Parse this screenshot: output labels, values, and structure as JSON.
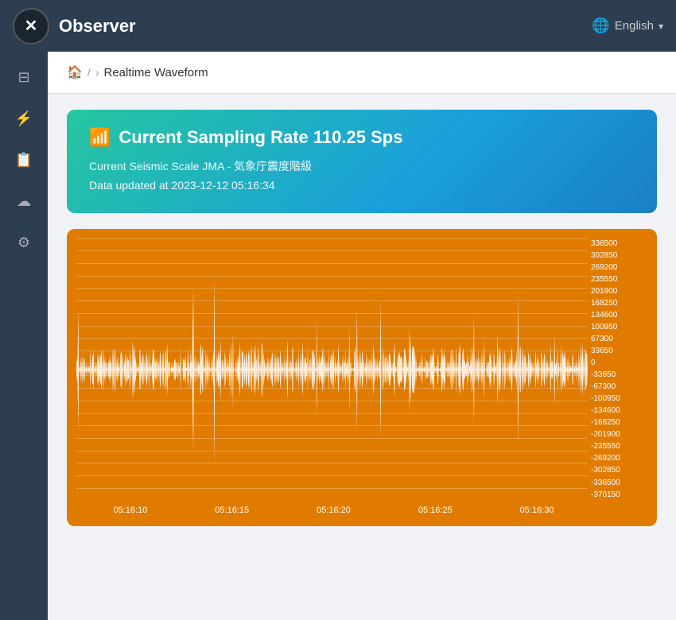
{
  "header": {
    "title": "Observer",
    "logo_symbol": "✕",
    "language": "English"
  },
  "sidebar": {
    "items": [
      {
        "icon": "⊟",
        "name": "dashboard"
      },
      {
        "icon": "⚡",
        "name": "waveform"
      },
      {
        "icon": "📋",
        "name": "reports"
      },
      {
        "icon": "☁",
        "name": "cloud"
      },
      {
        "icon": "⚙",
        "name": "settings"
      }
    ]
  },
  "breadcrumb": {
    "home_label": "🏠",
    "separator1": "/",
    "separator2": "›",
    "page": "Realtime Waveform"
  },
  "info_card": {
    "title": "Current Sampling Rate 110.25 Sps",
    "subtitle1": "Current Seismic Scale JMA - 気象庁震度階級",
    "subtitle2": "Data updated at 2023-12-12 05:16:34"
  },
  "waveform": {
    "yaxis_labels": [
      "336500",
      "302850",
      "269200",
      "235550",
      "201900",
      "168250",
      "134600",
      "100950",
      "67300",
      "33650",
      "0",
      "-33650",
      "-67300",
      "-100950",
      "-134600",
      "-168250",
      "-201900",
      "-235550",
      "-269200",
      "-302850",
      "-336500",
      "-370150"
    ],
    "xaxis_labels": [
      "05:16:10",
      "05:16:15",
      "05:16:20",
      "05:16:25",
      "05:16:30"
    ]
  }
}
